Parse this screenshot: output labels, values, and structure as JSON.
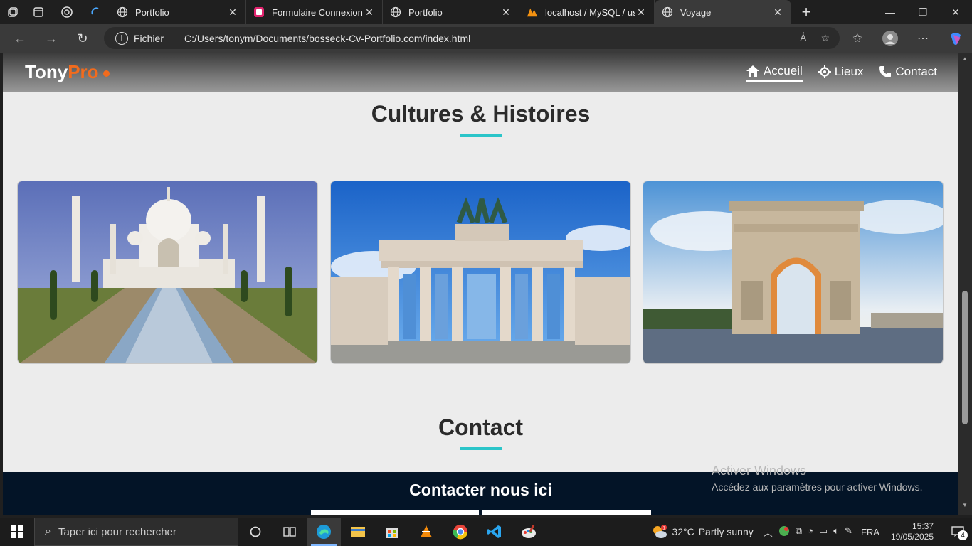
{
  "browser": {
    "tabs": [
      {
        "title": "Portfolio",
        "icon": "globe-icon",
        "active": false
      },
      {
        "title": "Formulaire Connexion | I",
        "icon": "app-icon",
        "active": false
      },
      {
        "title": "Portfolio",
        "icon": "globe-icon",
        "active": false
      },
      {
        "title": "localhost / MySQL / user",
        "icon": "phpmyadmin-icon",
        "active": false
      },
      {
        "title": "Voyage",
        "icon": "globe-icon",
        "active": true
      }
    ],
    "address": {
      "protocol_label": "Fichier",
      "url": "C:/Users/tonym/Documents/bosseck-Cv-Portfolio.com/index.html"
    },
    "new_tab": "+"
  },
  "site": {
    "logo": {
      "part1": "Tony",
      "part2": "Pro"
    },
    "nav": [
      {
        "label": "Accueil",
        "icon": "home-icon"
      },
      {
        "label": "Lieux",
        "icon": "location-icon"
      },
      {
        "label": "Contact",
        "icon": "phone-icon"
      }
    ],
    "section_title": "Cultures & Histoires",
    "cards": [
      {
        "subject": "taj-mahal"
      },
      {
        "subject": "brandenburg-gate"
      },
      {
        "subject": "arc-de-triomphe"
      }
    ],
    "contact_title": "Contact",
    "contact_band_title": "Contacter nous ici"
  },
  "watermark": {
    "line1": "Activer Windows",
    "line2": "Accédez aux paramètres pour activer Windows."
  },
  "taskbar": {
    "search_placeholder": "Taper ici pour rechercher",
    "weather": {
      "temp": "32°C",
      "desc": "Partly sunny",
      "badge": "1"
    },
    "lang": "FRA",
    "time": "15:37",
    "date": "19/05/2025",
    "notif_count": "4"
  },
  "colors": {
    "accent_orange": "#f26b1d",
    "underline_teal": "#2bc5c9",
    "contact_band": "#031427"
  }
}
